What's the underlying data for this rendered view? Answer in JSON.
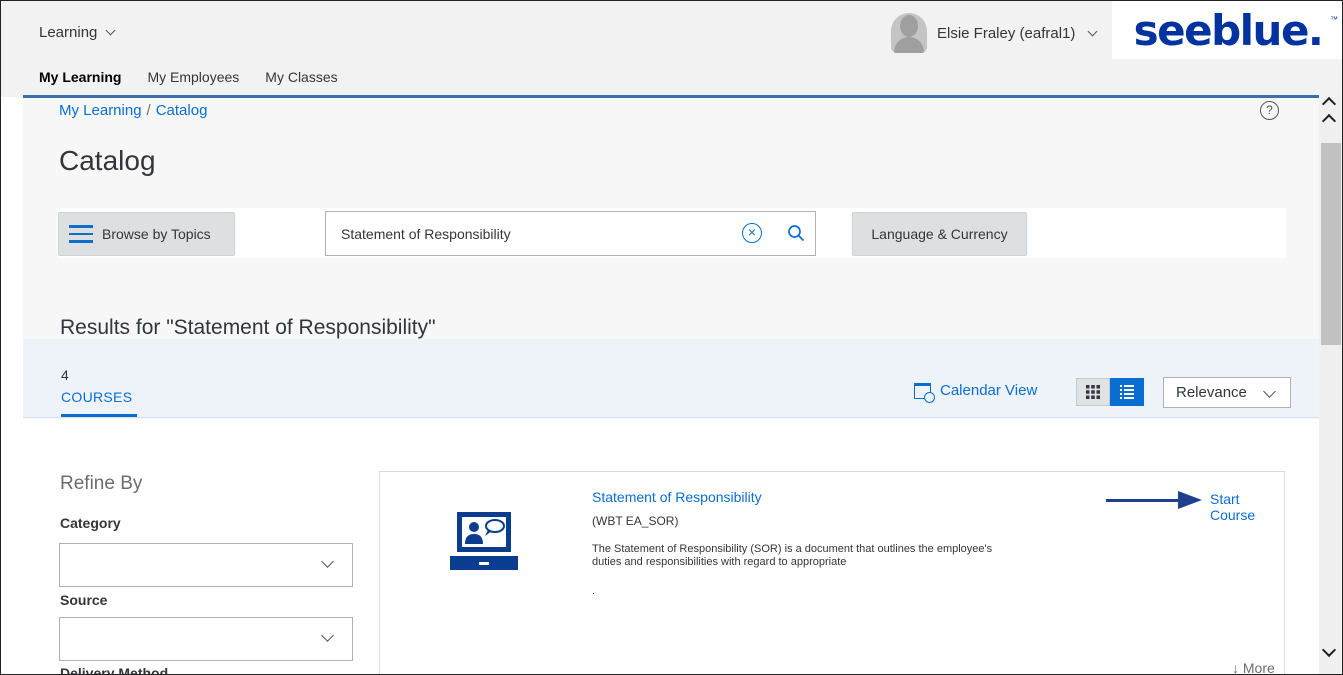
{
  "shell": {
    "app_menu_label": "Learning",
    "user_name": "Elsie Fraley (eafral1)",
    "logo_text": "seeblue.",
    "logo_tm": "™"
  },
  "tabs": [
    {
      "label": "My Learning",
      "active": true
    },
    {
      "label": "My Employees",
      "active": false
    },
    {
      "label": "My Classes",
      "active": false
    }
  ],
  "breadcrumb": {
    "items": [
      "My Learning",
      "Catalog"
    ],
    "separator": "/"
  },
  "help_label": "?",
  "page_title": "Catalog",
  "toolbar": {
    "browse_label": "Browse by Topics",
    "search_value": "Statement of Responsibility",
    "clear_symbol": "×",
    "language_label": "Language & Currency"
  },
  "results": {
    "title": "Results for \"Statement of Responsibility\"",
    "count": "4",
    "type_label": "COURSES",
    "calendar_label": "Calendar View",
    "sort_value": "Relevance"
  },
  "refine": {
    "title": "Refine By",
    "filters": [
      {
        "label": "Category",
        "value": ""
      },
      {
        "label": "Source",
        "value": ""
      }
    ],
    "next_label": "Delivery Method"
  },
  "course": {
    "title": "Statement of Responsibility",
    "code": "(WBT EA_SOR)",
    "description": "The Statement of Responsibility (SOR) is a document that outlines the employee's duties and responsibilities with regard to appropriate",
    "trailing": ".",
    "start_label": "Start Course",
    "more_label": "↓ More"
  },
  "colors": {
    "accent": "#0a6ed1",
    "brand": "#0033a0",
    "arrow": "#1f3f8f"
  }
}
